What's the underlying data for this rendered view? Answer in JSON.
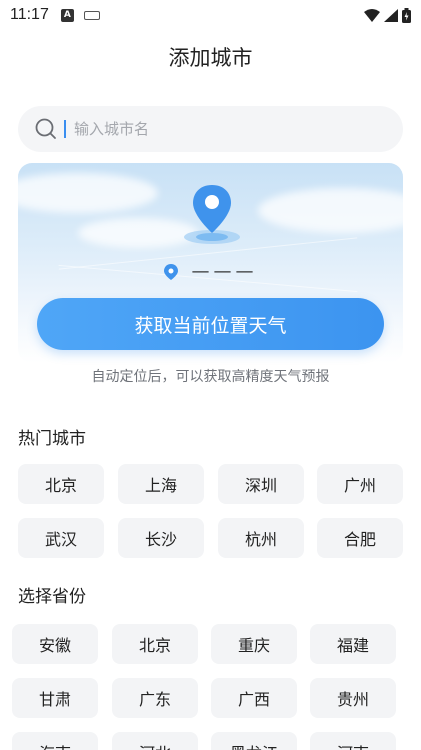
{
  "status_bar": {
    "time": "11:17",
    "a_badge": "A",
    "icons": [
      "wifi-icon",
      "cellular-signal-icon",
      "battery-icon"
    ]
  },
  "page": {
    "title": "添加城市"
  },
  "search": {
    "placeholder": "输入城市名",
    "icon": "search-icon"
  },
  "locate": {
    "current_location": "———",
    "button_label": "获取当前位置天气",
    "hint": "自动定位后，可以获取高精度天气预报"
  },
  "hot_cities": {
    "title": "热门城市",
    "items": [
      "北京",
      "上海",
      "深圳",
      "广州",
      "武汉",
      "长沙",
      "杭州",
      "合肥"
    ]
  },
  "provinces": {
    "title": "选择省份",
    "items": [
      "安徽",
      "北京",
      "重庆",
      "福建",
      "甘肃",
      "广东",
      "广西",
      "贵州",
      "海南",
      "河北",
      "黑龙江",
      "河南"
    ]
  },
  "colors": {
    "accent": "#3c94f0",
    "chip_bg": "#f3f4f6",
    "search_bg": "#f4f5f7"
  }
}
